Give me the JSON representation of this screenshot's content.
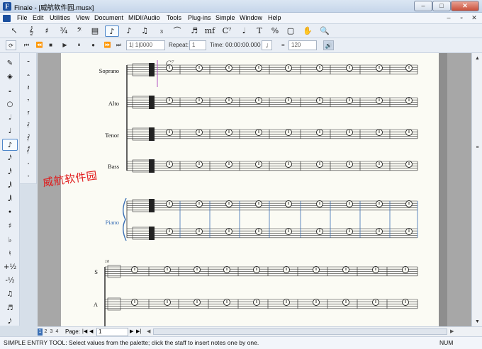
{
  "window": {
    "title": "Finale - [威航软件园.musx]",
    "app_icon_glyph": "F",
    "controls": [
      "–",
      "□",
      "✕"
    ]
  },
  "menu": {
    "items": [
      "File",
      "Edit",
      "Utilities",
      "View",
      "Document",
      "MIDI/Audio",
      "Tools",
      "Plug-ins",
      "Simple",
      "Window",
      "Help"
    ],
    "mdi_controls": [
      "–",
      "▫",
      "✕"
    ]
  },
  "main_palette": {
    "tools": [
      {
        "name": "selection-tool-icon",
        "glyph": "↖"
      },
      {
        "name": "staff-tool-icon",
        "glyph": "𝄞"
      },
      {
        "name": "key-signature-tool-icon",
        "glyph": "♯"
      },
      {
        "name": "time-signature-tool-icon",
        "glyph": "¾"
      },
      {
        "name": "clef-tool-icon",
        "glyph": "𝄢"
      },
      {
        "name": "measure-tool-icon",
        "glyph": "▤"
      },
      {
        "name": "simple-entry-tool-icon",
        "glyph": "♪",
        "selected": true
      },
      {
        "name": "speedy-entry-tool-icon",
        "glyph": "♪"
      },
      {
        "name": "articulation-tool-icon",
        "glyph": "♫"
      },
      {
        "name": "tuplet-tool-icon",
        "glyph": "₃"
      },
      {
        "name": "smart-shape-tool-icon",
        "glyph": "⌒"
      },
      {
        "name": "expression-tool-icon",
        "glyph": "♬"
      },
      {
        "name": "dynamics-tool-icon",
        "glyph": "mf"
      },
      {
        "name": "chord-tool-icon",
        "glyph": "C⁷"
      },
      {
        "name": "lyrics-tool-icon",
        "glyph": "𝅘𝅥"
      },
      {
        "name": "text-tool-icon",
        "glyph": "T"
      },
      {
        "name": "resize-tool-icon",
        "glyph": "%"
      },
      {
        "name": "page-layout-tool-icon",
        "glyph": "▢"
      },
      {
        "name": "hand-grabber-tool-icon",
        "glyph": "✋"
      },
      {
        "name": "zoom-tool-icon",
        "glyph": "🔍"
      }
    ]
  },
  "playback": {
    "buttons": [
      "⟳",
      "⏮",
      "⏪",
      "■",
      "▶",
      "⏸",
      "●",
      "⏩",
      "⏭"
    ],
    "counter": "1| 1|0000",
    "repeat_label": "Repeat:",
    "repeat_value": "1",
    "time_label": "Time:",
    "time_value": "00:00:00.000",
    "tempo_equals": "=",
    "tempo_value": "120"
  },
  "left_palette_1": [
    "✎",
    "◈",
    "𝅝",
    "○",
    "𝅗𝅥",
    "♩",
    "♪",
    "𝅘𝅥𝅯",
    "𝅘𝅥𝅰",
    "𝅘𝅥𝅱",
    "𝅘𝅥𝅲",
    "•",
    "♯",
    "♭",
    "♮",
    "+½",
    "-½",
    "♫",
    "♬",
    "𝅘𝅥𝅮"
  ],
  "left_palette_2": [
    "𝄻",
    "𝄼",
    "𝄽",
    "𝄾",
    "𝄿",
    "𝅀",
    "𝅁",
    "𝅂",
    "𝅃",
    "𝅄"
  ],
  "score": {
    "system1_staves": [
      "Soprano",
      "Alto",
      "Tenor",
      "Bass"
    ],
    "piano_label": "Piano",
    "system2_staves": [
      "S",
      "A"
    ],
    "system2_measure_number": "10",
    "chord_symbol": "C⁷"
  },
  "watermark": "威航软件园",
  "navigation": {
    "pages": [
      "1",
      "2",
      "3",
      "4"
    ],
    "page_label": "Page:",
    "page_value": "1"
  },
  "status": {
    "text": "SIMPLE ENTRY TOOL: Select values from the palette; click the staff to insert notes one by one.",
    "num": "NUM"
  }
}
